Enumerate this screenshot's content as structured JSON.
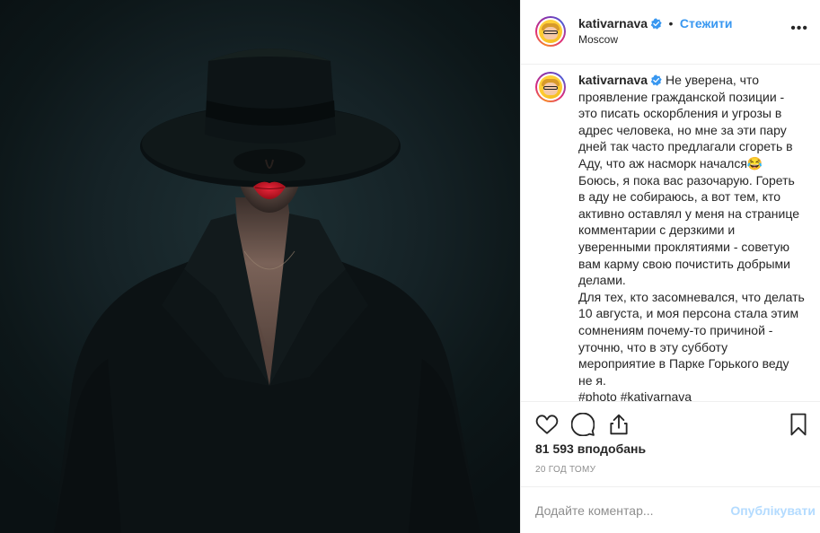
{
  "post": {
    "username": "kativarnava",
    "separator": "•",
    "follow_label": "Стежити",
    "location": "Moscow",
    "more_label": "•••",
    "caption_username": "kativarnava",
    "caption": "Не уверена, что проявление гражданской позиции - это писать оскорбления и угрозы в адрес человека, но мне за эти пару дней так часто предлагали сгореть в Аду, что аж насморк начался😂 Боюсь, я пока вас разочарую. Гореть в аду не собираюсь, а вот тем, кто активно оставлял у меня на странице комментарии с дерзкими и уверенными проклятиями - советую вам карму свою почистить добрыми делами.\nДля тех, кто засомневался, что делать 10 августа, и моя персона стала этим сомнениям почему-то причиной - уточню, что в эту субботу мероприятие в Парке Горького веду не я.\n#photo #kativarnava",
    "likes": "81 593 вподобань",
    "time": "20 ГОД ТОМУ"
  },
  "comment": {
    "placeholder": "Додайте коментар...",
    "publish_label": "Опублікувати"
  },
  "colors": {
    "accent": "#3897f0",
    "publish_disabled": "#b3dbff",
    "lips": "#c4111f",
    "photo_bg": "#152226"
  },
  "icons": [
    "verified-badge-icon",
    "more-options-icon",
    "heart-icon",
    "comment-icon",
    "share-icon",
    "bookmark-icon"
  ]
}
